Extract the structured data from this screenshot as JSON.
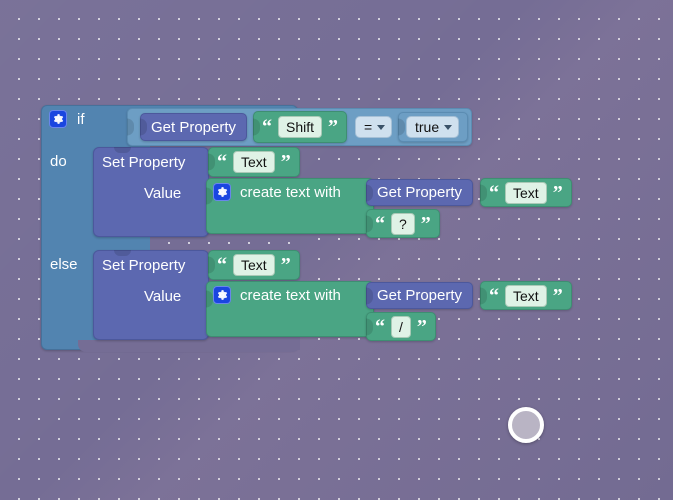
{
  "editor": {
    "name": "blocks-editor-canvas",
    "background_color": "#756d95",
    "grid_dot_color": "#ffffff"
  },
  "colors": {
    "control_block": "#5284b0",
    "statement_block": "#5c68b0",
    "text_block": "#4aa584",
    "logic_block": "#6d9ec4",
    "field_background": "#dff2e6",
    "dropdown_background": "#cfe0ee",
    "mutator_icon": "#1a46e0"
  },
  "blocks": {
    "if_block": {
      "if_label": "if",
      "do_label": "do",
      "else_label": "else",
      "mutator_icon": "gear-icon"
    },
    "condition": {
      "left": {
        "getter_label": "Get Property",
        "property_value": "Shift",
        "open_quote": "“",
        "close_quote": "”"
      },
      "operator": "=",
      "right": "true"
    },
    "do_branch": {
      "set_property_label": "Set Property",
      "property_value": "Text",
      "value_label": "Value",
      "create_text_label": "create text with",
      "create_text_icon": "gear-icon",
      "item1": {
        "getter_label": "Get Property",
        "property_value": "Text"
      },
      "item2": {
        "text_value": "?"
      }
    },
    "else_branch": {
      "set_property_label": "Set Property",
      "property_value": "Text",
      "value_label": "Value",
      "create_text_label": "create text with",
      "create_text_icon": "gear-icon",
      "item1": {
        "getter_label": "Get Property",
        "property_value": "Text"
      },
      "item2": {
        "text_value": "/"
      }
    }
  },
  "pointer": {
    "name": "touch-pointer-indicator"
  }
}
